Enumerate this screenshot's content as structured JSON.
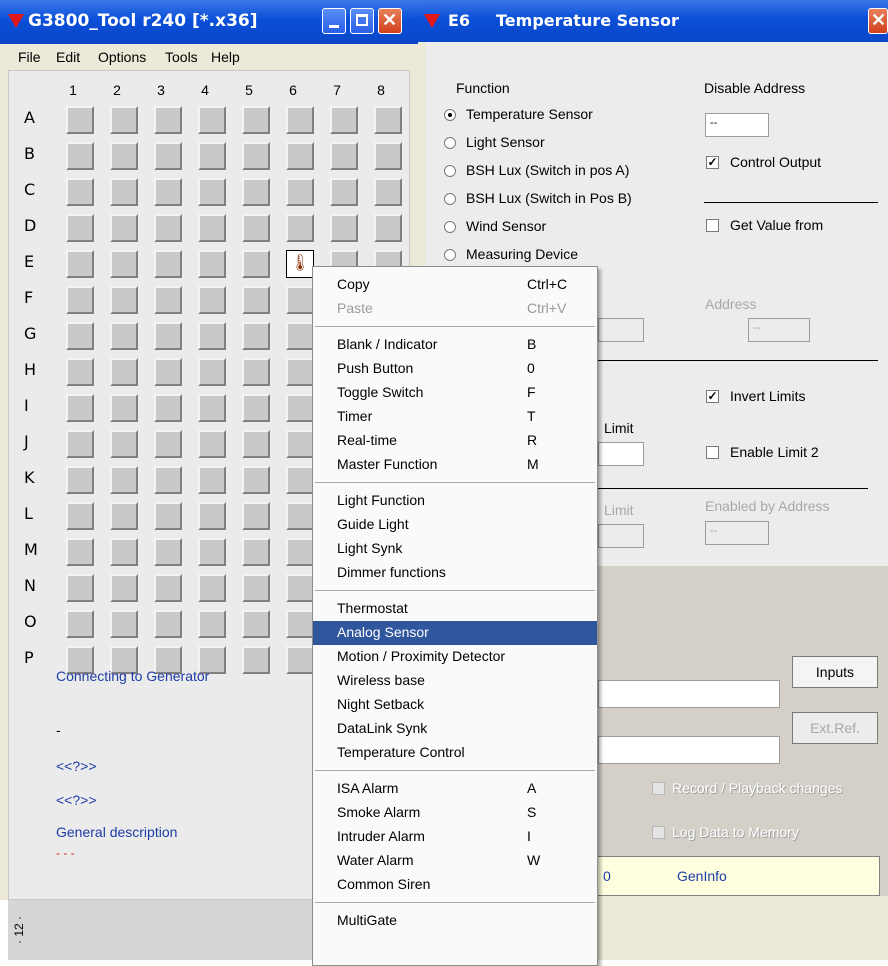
{
  "left_window": {
    "title": "G3800_Tool r240 [*.x36]",
    "menu": [
      "File",
      "Edit",
      "Options",
      "Tools",
      "Help"
    ],
    "columns": [
      "1",
      "2",
      "3",
      "4",
      "5",
      "6",
      "7",
      "8"
    ],
    "rows": [
      "A",
      "B",
      "C",
      "D",
      "E",
      "F",
      "G",
      "H",
      "I",
      "J",
      "K",
      "L",
      "M",
      "N",
      "O",
      "P"
    ],
    "selected_cell": "E6",
    "status_link": "Connecting to Generator",
    "dash": "-",
    "placeholder1": "<<?>>",
    "placeholder2": "<<?>>",
    "general_description": "General description",
    "red_dashes": "- - -",
    "bottom_strip_text": "· 12 ·"
  },
  "right_window": {
    "title_prefix": "E6",
    "title": "Temperature Sensor",
    "function_label": "Function",
    "functions": [
      {
        "label": "Temperature Sensor",
        "selected": true
      },
      {
        "label": "Light Sensor",
        "selected": false
      },
      {
        "label": "BSH Lux  (Switch in pos A)",
        "selected": false
      },
      {
        "label": "BSH Lux (Switch in Pos B)",
        "selected": false
      },
      {
        "label": "Wind Sensor",
        "selected": false
      },
      {
        "label": "Measuring Device",
        "selected": false
      }
    ],
    "disable_address_label": "Disable Address",
    "disable_address_value": "--",
    "control_output_label": "Control Output",
    "control_output_checked": true,
    "get_value_label": "Get Value from",
    "get_value_checked": false,
    "address_label": "Address",
    "address_value": "--",
    "invert_limits_label": "Invert Limits",
    "invert_limits_checked": true,
    "limit_label_1": "Limit",
    "enable_limit2_label": "Enable Limit 2",
    "enable_limit2_checked": false,
    "limit_label_2": "Limit",
    "enabled_by_address_label": "Enabled by Address",
    "enabled_by_address_value": "--",
    "inputs_button": "Inputs",
    "extref_button": "Ext.Ref.",
    "record_playback_label": "Record / Playback changes",
    "log_data_label": "Log Data to Memory",
    "status_zero": "0",
    "geninfo": "GenInfo"
  },
  "context_menu": {
    "groups": [
      [
        {
          "label": "Copy",
          "shortcut": "Ctrl+C",
          "disabled": false
        },
        {
          "label": "Paste",
          "shortcut": "Ctrl+V",
          "disabled": true
        }
      ],
      [
        {
          "label": "Blank / Indicator",
          "shortcut": "B"
        },
        {
          "label": "Push Button",
          "shortcut": "0"
        },
        {
          "label": "Toggle Switch",
          "shortcut": "F"
        },
        {
          "label": "Timer",
          "shortcut": "T"
        },
        {
          "label": "Real-time",
          "shortcut": "R"
        },
        {
          "label": "Master Function",
          "shortcut": "M"
        }
      ],
      [
        {
          "label": "Light Function",
          "shortcut": ""
        },
        {
          "label": "Guide Light",
          "shortcut": ""
        },
        {
          "label": "Light Synk",
          "shortcut": ""
        },
        {
          "label": "Dimmer functions",
          "shortcut": ""
        }
      ],
      [
        {
          "label": "Thermostat",
          "shortcut": ""
        },
        {
          "label": "Analog Sensor",
          "shortcut": "",
          "highlighted": true
        },
        {
          "label": "Motion / Proximity Detector",
          "shortcut": ""
        },
        {
          "label": "Wireless base",
          "shortcut": ""
        },
        {
          "label": "Night Setback",
          "shortcut": ""
        },
        {
          "label": "DataLink Synk",
          "shortcut": ""
        },
        {
          "label": "Temperature Control",
          "shortcut": ""
        }
      ],
      [
        {
          "label": "ISA Alarm",
          "shortcut": "A"
        },
        {
          "label": "Smoke Alarm",
          "shortcut": "S"
        },
        {
          "label": "Intruder Alarm",
          "shortcut": "I"
        },
        {
          "label": "Water Alarm",
          "shortcut": "W"
        },
        {
          "label": "Common Siren",
          "shortcut": ""
        }
      ],
      [
        {
          "label": "MultiGate",
          "shortcut": ""
        }
      ]
    ]
  },
  "colors": {
    "titlebar": "#0a4fd8",
    "menu_highlight": "#30569e",
    "link_blue": "#1e3ca8",
    "red": "#e01818"
  }
}
